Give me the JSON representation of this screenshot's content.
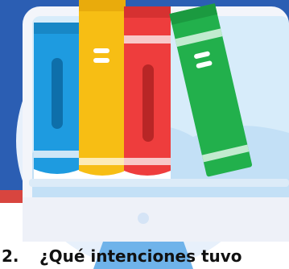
{
  "question": {
    "number": "2.",
    "text": "¿Qué intenciones tuvo"
  },
  "colors": {
    "background_blue": "#2B5EB3",
    "screen_light_blue": "#D7ECFA",
    "book_blue": "#1E9BE0",
    "book_yellow": "#F7BE14",
    "book_red": "#EE3D3D",
    "book_green": "#22B04C",
    "monitor_frame": "#EEF1F8",
    "text": "#111111"
  },
  "icons": {
    "illustration": "library-books-monitor-icon"
  }
}
